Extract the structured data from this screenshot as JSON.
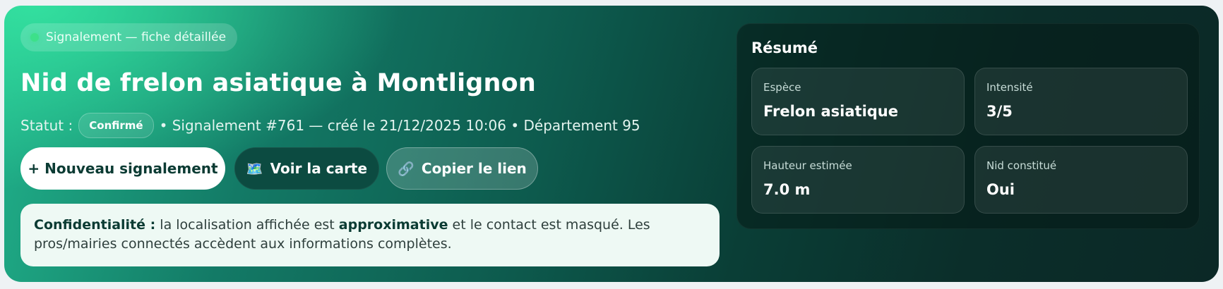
{
  "header": {
    "tag_label": "Signalement — fiche détaillée",
    "title": "Nid de frelon asiatique à Montlignon",
    "status_prefix": "Statut :",
    "status_badge": "Confirmé",
    "meta_text": "• Signalement #761 — créé le 21/12/2025 10:06 • Département 95"
  },
  "actions": {
    "new_report": "+ Nouveau signalement",
    "view_map": "Voir la carte",
    "view_map_icon": "🗺️",
    "copy_link": "Copier le lien",
    "copy_link_icon": "🔗"
  },
  "notice": {
    "bold_prefix": "Confidentialité :",
    "text_before": " la localisation affichée est ",
    "bold_mid": "approximative",
    "text_after": " et le contact est masqué. Les pros/mairies connectés accèdent aux informations complètes."
  },
  "summary": {
    "title": "Résumé",
    "cards": [
      {
        "label": "Espèce",
        "value": "Frelon asiatique"
      },
      {
        "label": "Intensité",
        "value": "3/5"
      },
      {
        "label": "Hauteur estimée",
        "value": "7.0 m"
      },
      {
        "label": "Nid constitué",
        "value": "Oui"
      }
    ]
  },
  "colors": {
    "accent_dot": "#3de08a",
    "primary_text": "#0b3b33"
  }
}
